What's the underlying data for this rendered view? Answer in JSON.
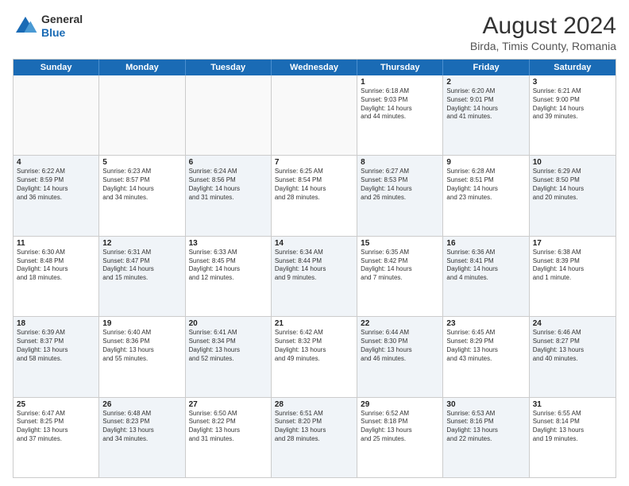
{
  "header": {
    "logo": {
      "general": "General",
      "blue": "Blue"
    },
    "title": "August 2024",
    "subtitle": "Birda, Timis County, Romania"
  },
  "weekdays": [
    "Sunday",
    "Monday",
    "Tuesday",
    "Wednesday",
    "Thursday",
    "Friday",
    "Saturday"
  ],
  "rows": [
    {
      "cells": [
        {
          "day": "",
          "info": "",
          "shaded": false,
          "empty": true
        },
        {
          "day": "",
          "info": "",
          "shaded": false,
          "empty": true
        },
        {
          "day": "",
          "info": "",
          "shaded": false,
          "empty": true
        },
        {
          "day": "",
          "info": "",
          "shaded": false,
          "empty": true
        },
        {
          "day": "1",
          "info": "Sunrise: 6:18 AM\nSunset: 9:03 PM\nDaylight: 14 hours\nand 44 minutes.",
          "shaded": false,
          "empty": false
        },
        {
          "day": "2",
          "info": "Sunrise: 6:20 AM\nSunset: 9:01 PM\nDaylight: 14 hours\nand 41 minutes.",
          "shaded": true,
          "empty": false
        },
        {
          "day": "3",
          "info": "Sunrise: 6:21 AM\nSunset: 9:00 PM\nDaylight: 14 hours\nand 39 minutes.",
          "shaded": false,
          "empty": false
        }
      ]
    },
    {
      "cells": [
        {
          "day": "4",
          "info": "Sunrise: 6:22 AM\nSunset: 8:59 PM\nDaylight: 14 hours\nand 36 minutes.",
          "shaded": true,
          "empty": false
        },
        {
          "day": "5",
          "info": "Sunrise: 6:23 AM\nSunset: 8:57 PM\nDaylight: 14 hours\nand 34 minutes.",
          "shaded": false,
          "empty": false
        },
        {
          "day": "6",
          "info": "Sunrise: 6:24 AM\nSunset: 8:56 PM\nDaylight: 14 hours\nand 31 minutes.",
          "shaded": true,
          "empty": false
        },
        {
          "day": "7",
          "info": "Sunrise: 6:25 AM\nSunset: 8:54 PM\nDaylight: 14 hours\nand 28 minutes.",
          "shaded": false,
          "empty": false
        },
        {
          "day": "8",
          "info": "Sunrise: 6:27 AM\nSunset: 8:53 PM\nDaylight: 14 hours\nand 26 minutes.",
          "shaded": true,
          "empty": false
        },
        {
          "day": "9",
          "info": "Sunrise: 6:28 AM\nSunset: 8:51 PM\nDaylight: 14 hours\nand 23 minutes.",
          "shaded": false,
          "empty": false
        },
        {
          "day": "10",
          "info": "Sunrise: 6:29 AM\nSunset: 8:50 PM\nDaylight: 14 hours\nand 20 minutes.",
          "shaded": true,
          "empty": false
        }
      ]
    },
    {
      "cells": [
        {
          "day": "11",
          "info": "Sunrise: 6:30 AM\nSunset: 8:48 PM\nDaylight: 14 hours\nand 18 minutes.",
          "shaded": false,
          "empty": false
        },
        {
          "day": "12",
          "info": "Sunrise: 6:31 AM\nSunset: 8:47 PM\nDaylight: 14 hours\nand 15 minutes.",
          "shaded": true,
          "empty": false
        },
        {
          "day": "13",
          "info": "Sunrise: 6:33 AM\nSunset: 8:45 PM\nDaylight: 14 hours\nand 12 minutes.",
          "shaded": false,
          "empty": false
        },
        {
          "day": "14",
          "info": "Sunrise: 6:34 AM\nSunset: 8:44 PM\nDaylight: 14 hours\nand 9 minutes.",
          "shaded": true,
          "empty": false
        },
        {
          "day": "15",
          "info": "Sunrise: 6:35 AM\nSunset: 8:42 PM\nDaylight: 14 hours\nand 7 minutes.",
          "shaded": false,
          "empty": false
        },
        {
          "day": "16",
          "info": "Sunrise: 6:36 AM\nSunset: 8:41 PM\nDaylight: 14 hours\nand 4 minutes.",
          "shaded": true,
          "empty": false
        },
        {
          "day": "17",
          "info": "Sunrise: 6:38 AM\nSunset: 8:39 PM\nDaylight: 14 hours\nand 1 minute.",
          "shaded": false,
          "empty": false
        }
      ]
    },
    {
      "cells": [
        {
          "day": "18",
          "info": "Sunrise: 6:39 AM\nSunset: 8:37 PM\nDaylight: 13 hours\nand 58 minutes.",
          "shaded": true,
          "empty": false
        },
        {
          "day": "19",
          "info": "Sunrise: 6:40 AM\nSunset: 8:36 PM\nDaylight: 13 hours\nand 55 minutes.",
          "shaded": false,
          "empty": false
        },
        {
          "day": "20",
          "info": "Sunrise: 6:41 AM\nSunset: 8:34 PM\nDaylight: 13 hours\nand 52 minutes.",
          "shaded": true,
          "empty": false
        },
        {
          "day": "21",
          "info": "Sunrise: 6:42 AM\nSunset: 8:32 PM\nDaylight: 13 hours\nand 49 minutes.",
          "shaded": false,
          "empty": false
        },
        {
          "day": "22",
          "info": "Sunrise: 6:44 AM\nSunset: 8:30 PM\nDaylight: 13 hours\nand 46 minutes.",
          "shaded": true,
          "empty": false
        },
        {
          "day": "23",
          "info": "Sunrise: 6:45 AM\nSunset: 8:29 PM\nDaylight: 13 hours\nand 43 minutes.",
          "shaded": false,
          "empty": false
        },
        {
          "day": "24",
          "info": "Sunrise: 6:46 AM\nSunset: 8:27 PM\nDaylight: 13 hours\nand 40 minutes.",
          "shaded": true,
          "empty": false
        }
      ]
    },
    {
      "cells": [
        {
          "day": "25",
          "info": "Sunrise: 6:47 AM\nSunset: 8:25 PM\nDaylight: 13 hours\nand 37 minutes.",
          "shaded": false,
          "empty": false
        },
        {
          "day": "26",
          "info": "Sunrise: 6:48 AM\nSunset: 8:23 PM\nDaylight: 13 hours\nand 34 minutes.",
          "shaded": true,
          "empty": false
        },
        {
          "day": "27",
          "info": "Sunrise: 6:50 AM\nSunset: 8:22 PM\nDaylight: 13 hours\nand 31 minutes.",
          "shaded": false,
          "empty": false
        },
        {
          "day": "28",
          "info": "Sunrise: 6:51 AM\nSunset: 8:20 PM\nDaylight: 13 hours\nand 28 minutes.",
          "shaded": true,
          "empty": false
        },
        {
          "day": "29",
          "info": "Sunrise: 6:52 AM\nSunset: 8:18 PM\nDaylight: 13 hours\nand 25 minutes.",
          "shaded": false,
          "empty": false
        },
        {
          "day": "30",
          "info": "Sunrise: 6:53 AM\nSunset: 8:16 PM\nDaylight: 13 hours\nand 22 minutes.",
          "shaded": true,
          "empty": false
        },
        {
          "day": "31",
          "info": "Sunrise: 6:55 AM\nSunset: 8:14 PM\nDaylight: 13 hours\nand 19 minutes.",
          "shaded": false,
          "empty": false
        }
      ]
    }
  ]
}
